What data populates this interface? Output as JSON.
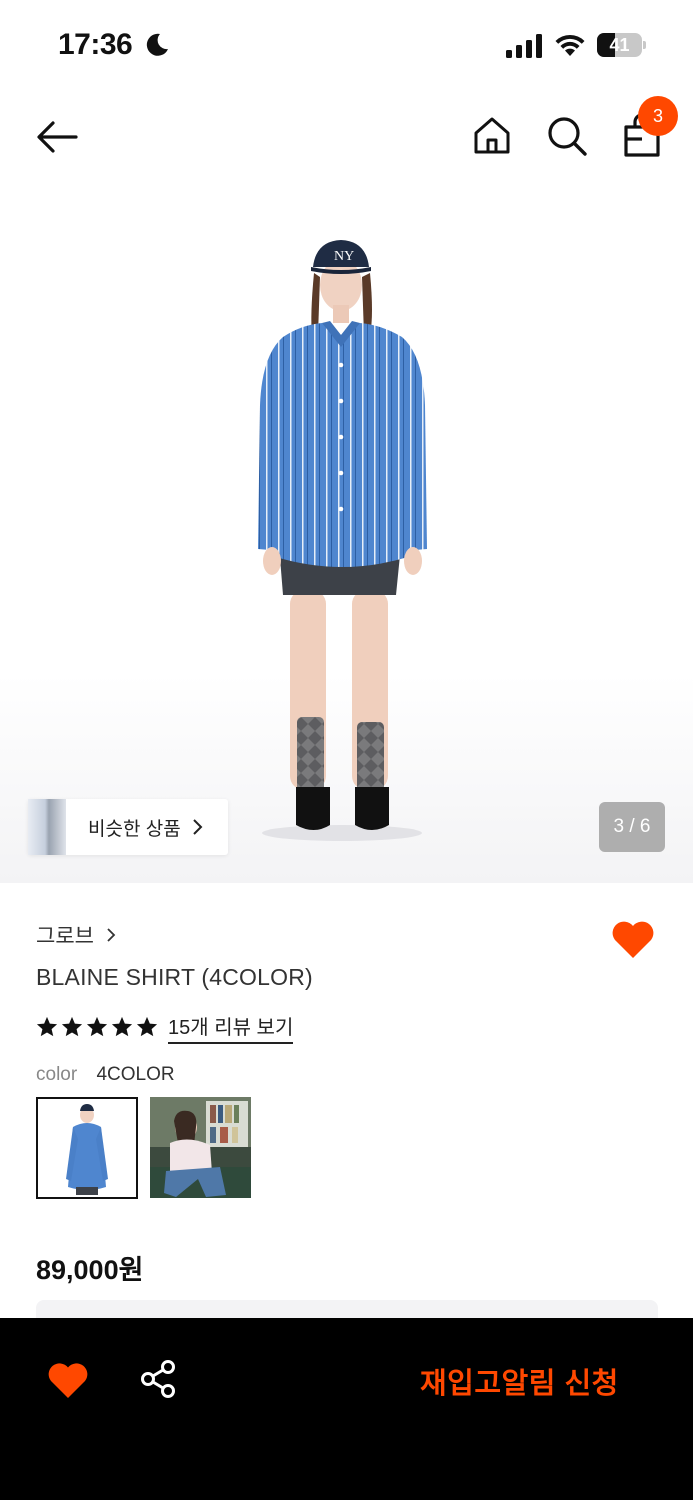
{
  "status_bar": {
    "time": "17:36",
    "battery_level": "41",
    "battery_fraction": 0.41
  },
  "nav": {
    "cart_count": "3",
    "icons": [
      "back-arrow-icon",
      "home-icon",
      "search-icon",
      "shopping-bag-icon"
    ]
  },
  "gallery": {
    "similar_label": "비슷한 상품",
    "page_indicator": "3 / 6"
  },
  "product": {
    "brand": "그로브",
    "name": "BLAINE SHIRT (4COLOR)",
    "rating": 5,
    "review_link": "15개 리뷰 보기",
    "color_label": "color",
    "color_value": "4COLOR",
    "price": "89,000원"
  },
  "bottom_bar": {
    "restock_label": "재입고알림 신청",
    "icons": [
      "heart-icon",
      "share-icon"
    ]
  },
  "colors": {
    "accent": "#ff4800",
    "bottom_bar_bg": "#000000"
  }
}
